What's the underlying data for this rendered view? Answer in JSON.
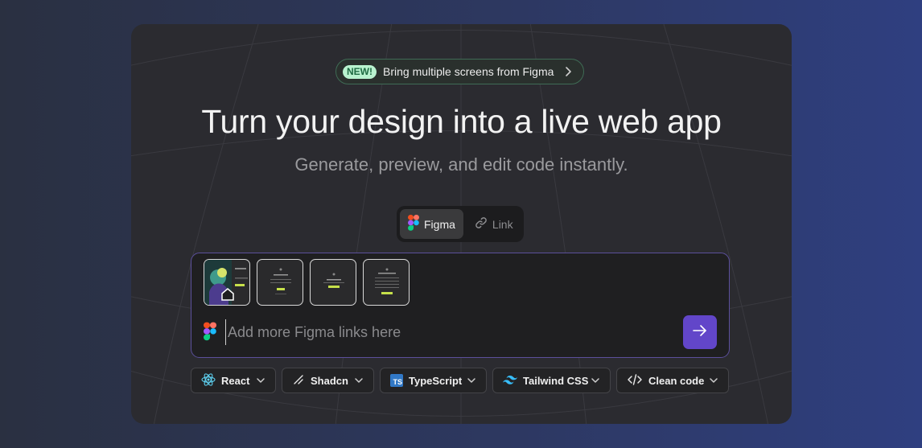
{
  "banner": {
    "badge": "NEW!",
    "text": "Bring multiple screens from Figma",
    "chevron_icon": "chevron-right-icon"
  },
  "hero": {
    "title": "Turn your design into a live web app",
    "subtitle": "Generate, preview, and edit code instantly."
  },
  "source_switch": {
    "options": [
      {
        "label": "Figma",
        "icon": "figma-icon",
        "active": true
      },
      {
        "label": "Link",
        "icon": "link-icon",
        "active": false
      }
    ]
  },
  "composer": {
    "placeholder": "Add more Figma links here",
    "value": "",
    "thumbnails": [
      {
        "name": "screen-1",
        "is_home": true
      },
      {
        "name": "screen-2",
        "is_home": false
      },
      {
        "name": "screen-3",
        "is_home": false
      },
      {
        "name": "screen-4",
        "is_home": false
      }
    ],
    "send_icon": "arrow-right-icon"
  },
  "options": [
    {
      "label": "React",
      "icon": "react-icon"
    },
    {
      "label": "Shadcn",
      "icon": "shadcn-icon"
    },
    {
      "label": "TypeScript",
      "icon": "typescript-icon",
      "icon_text": "TS"
    },
    {
      "label": "Tailwind CSS",
      "icon": "tailwind-icon"
    },
    {
      "label": "Clean code",
      "icon": "code-icon"
    }
  ],
  "colors": {
    "accent": "#6246C9",
    "badge_bg": "#B9F2CF",
    "badge_text": "#1F6B43",
    "card_bg": "#2B2B30"
  }
}
